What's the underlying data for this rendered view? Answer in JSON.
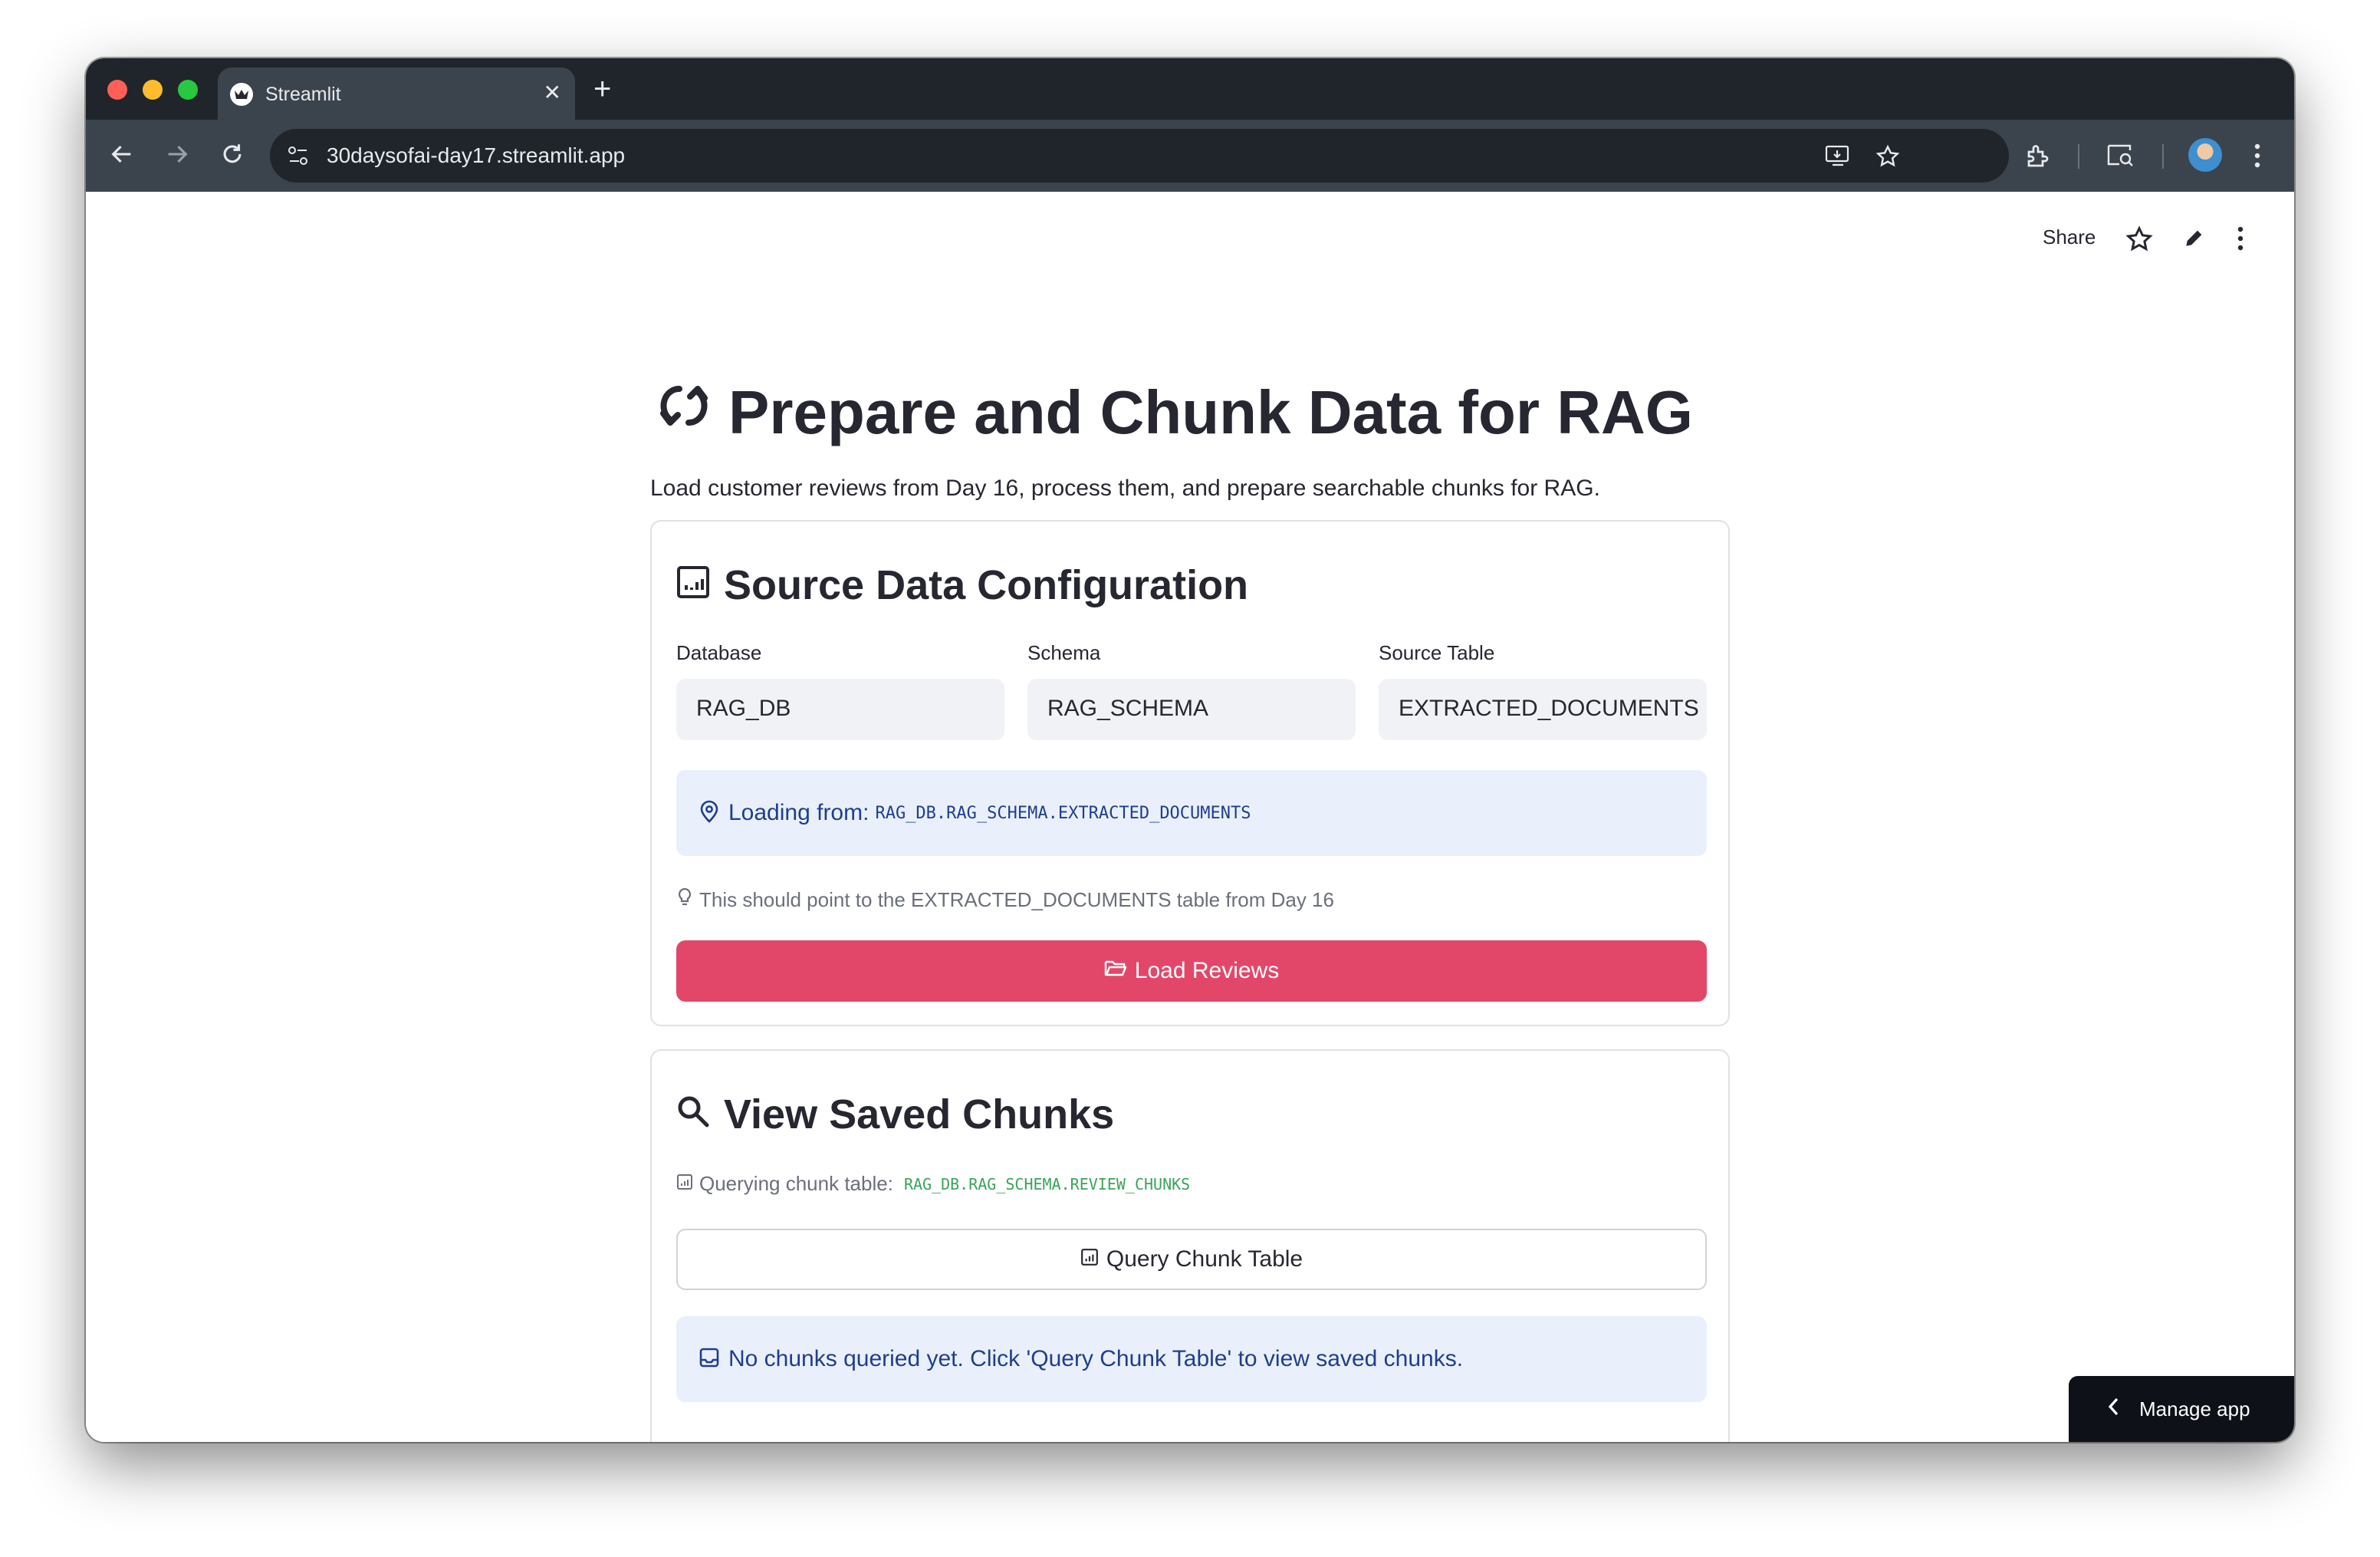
{
  "browser": {
    "tab_title": "Streamlit",
    "tab_close": "✕",
    "new_tab": "+",
    "url": "30daysofai-day17.streamlit.app"
  },
  "app_header": {
    "share_label": "Share"
  },
  "page": {
    "title": "Prepare and Chunk Data for RAG",
    "title_icon": "refresh-arrows-icon",
    "description": "Load customer reviews from Day 16, process them, and prepare searchable chunks for RAG."
  },
  "source_config": {
    "heading": "Source Data Configuration",
    "heading_icon": "bar-chart-icon",
    "fields": [
      {
        "label": "Database",
        "value": "RAG_DB"
      },
      {
        "label": "Schema",
        "value": "RAG_SCHEMA"
      },
      {
        "label": "Source Table",
        "value": "EXTRACTED_DOCUMENTS"
      }
    ],
    "loading_label": "Loading from:",
    "loading_path": "RAG_DB.RAG_SCHEMA.EXTRACTED_DOCUMENTS",
    "hint": "This should point to the EXTRACTED_DOCUMENTS table from Day 16",
    "load_button": "Load Reviews"
  },
  "saved_chunks": {
    "heading": "View Saved Chunks",
    "heading_icon": "search-icon",
    "querying_label": "Querying chunk table:",
    "chunk_table_path": "RAG_DB.RAG_SCHEMA.REVIEW_CHUNKS",
    "query_button": "Query Chunk Table",
    "empty_message": "No chunks queried yet. Click 'Query Chunk Table' to view saved chunks."
  },
  "manage_app": {
    "label": "Manage app"
  },
  "colors": {
    "primary_button": "#e2476a",
    "info_background": "#e9f0fc",
    "info_text": "#1f3e8c",
    "code_green": "#3aa35a",
    "input_background": "#f0f2f6",
    "browser_dark": "#20252b",
    "browser_toolbar": "#3b434c"
  }
}
